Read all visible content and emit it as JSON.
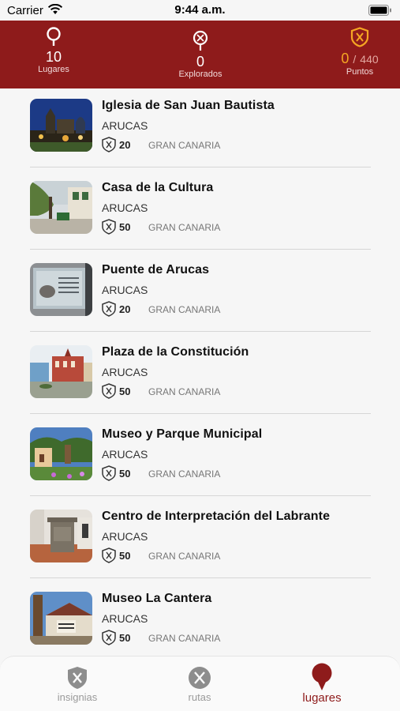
{
  "status_bar": {
    "carrier": "Carrier",
    "time": "9:44 a.m."
  },
  "header": {
    "lugares": {
      "value": "10",
      "label": "Lugares",
      "icon": "map-pin-icon"
    },
    "explorados": {
      "value": "0",
      "label": "Explorados",
      "icon": "explored-pin-icon"
    },
    "puntos": {
      "current": "0",
      "separator": "/",
      "total": "440",
      "label": "Puntos",
      "icon": "badge-shield-icon"
    }
  },
  "colors": {
    "brand": "#8e1b1b",
    "points_accent": "#f5a623",
    "background": "#f6f6f6"
  },
  "places": [
    {
      "name": "Iglesia de San Juan Bautista",
      "town": "ARUCAS",
      "points": "20",
      "island": "GRAN CANARIA",
      "thumb": "church-night-photo"
    },
    {
      "name": "Casa de la Cultura",
      "town": "ARUCAS",
      "points": "50",
      "island": "GRAN CANARIA",
      "thumb": "courtyard-tree-photo"
    },
    {
      "name": "Puente de Arucas",
      "town": "ARUCAS",
      "points": "20",
      "island": "GRAN CANARIA",
      "thumb": "plaque-photo"
    },
    {
      "name": "Plaza de la Constitución",
      "town": "ARUCAS",
      "points": "50",
      "island": "GRAN CANARIA",
      "thumb": "plaza-building-photo"
    },
    {
      "name": "Museo y Parque Municipal",
      "town": "ARUCAS",
      "points": "50",
      "island": "GRAN CANARIA",
      "thumb": "park-museum-photo"
    },
    {
      "name": "Centro de Interpretación del Labrante",
      "town": "ARUCAS",
      "points": "50",
      "island": "GRAN CANARIA",
      "thumb": "stone-font-photo"
    },
    {
      "name": "Museo La Cantera",
      "town": "ARUCAS",
      "points": "50",
      "island": "GRAN CANARIA",
      "thumb": "quarry-museum-photo"
    }
  ],
  "tabs": [
    {
      "label": "insignias",
      "icon": "badge-shield-icon",
      "active": false
    },
    {
      "label": "rutas",
      "icon": "routes-icon",
      "active": false
    },
    {
      "label": "lugares",
      "icon": "map-pin-icon",
      "active": true
    }
  ]
}
